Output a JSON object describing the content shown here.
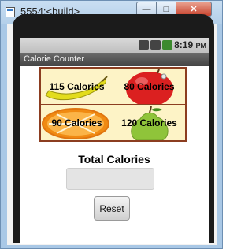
{
  "window": {
    "title": "5554:<build>",
    "minimize_icon": "minimize-icon",
    "maximize_icon": "maximize-icon",
    "close_icon": "close-icon",
    "close_glyph": "✕",
    "maximize_glyph": "□",
    "minimize_glyph": "—"
  },
  "statusbar": {
    "time": "8:19",
    "time_suffix": "PM",
    "icons": [
      "network-3g-icon",
      "signal-icon",
      "battery-icon"
    ]
  },
  "app": {
    "title": "Calorie Counter"
  },
  "tiles": [
    {
      "label": "115 Calories",
      "fruit": "banana",
      "color": "#d9d21a"
    },
    {
      "label": "80 Calories",
      "fruit": "apple",
      "color": "#d92121"
    },
    {
      "label": "90 Calories",
      "fruit": "orange",
      "color": "#f08a12"
    },
    {
      "label": "120 Calories",
      "fruit": "pear",
      "color": "#8fc43a"
    }
  ],
  "total": {
    "label": "Total Calories",
    "value": ""
  },
  "reset": {
    "label": "Reset"
  }
}
